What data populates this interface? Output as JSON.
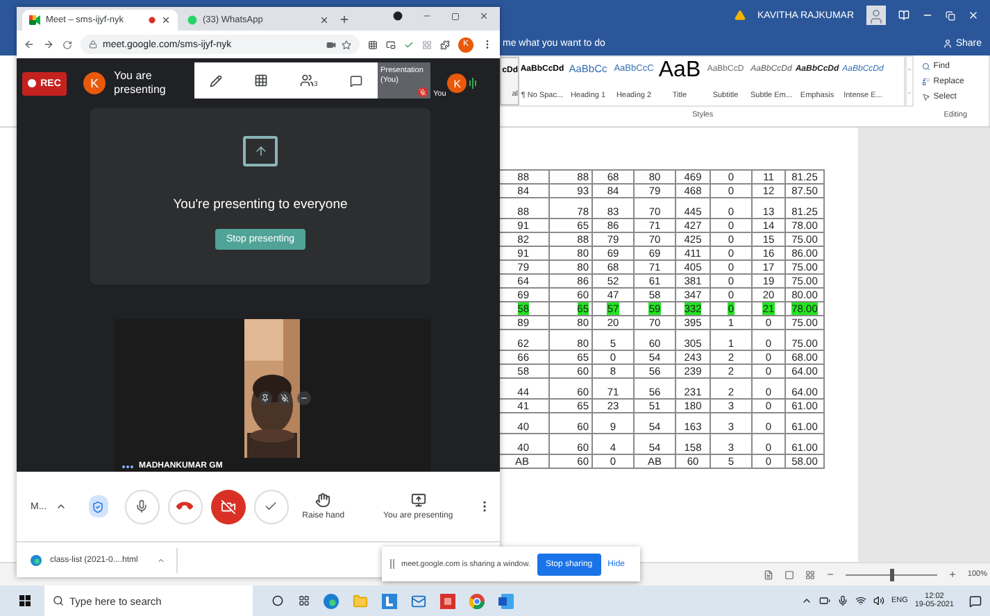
{
  "word": {
    "user": "KAVITHA RAJKUMAR",
    "tell_me": "me what you want to do",
    "share": "Share",
    "styles": [
      {
        "kind": "normal",
        "preview": "cDd",
        "label": "al",
        "selected": true
      },
      {
        "kind": "normal",
        "preview": "AaBbCcDd",
        "label": "¶ No Spac...",
        "selected": false
      },
      {
        "kind": "heading1",
        "preview": "AaBbCc",
        "label": "Heading 1",
        "selected": false
      },
      {
        "kind": "heading2",
        "preview": "AaBbCcC",
        "label": "Heading 2",
        "selected": false
      },
      {
        "kind": "title",
        "preview": "AaB",
        "label": "Title",
        "selected": false
      },
      {
        "kind": "subtitle",
        "preview": "AaBbCcD",
        "label": "Subtitle",
        "selected": false
      },
      {
        "kind": "subtle",
        "preview": "AaBbCcDd",
        "label": "Subtle Em...",
        "selected": false
      },
      {
        "kind": "emphasis",
        "preview": "AaBbCcDd",
        "label": "Emphasis",
        "selected": false
      },
      {
        "kind": "intense",
        "preview": "AaBbCcDd",
        "label": "Intense E...",
        "selected": false
      }
    ],
    "styles_group": "Styles",
    "editing": [
      {
        "kind": "find",
        "label": "Find"
      },
      {
        "kind": "replace",
        "label": "Replace"
      },
      {
        "kind": "select",
        "label": "Select"
      }
    ],
    "editing_group": "Editing",
    "table_rows": [
      {
        "cells": [
          "88",
          "88",
          "68",
          "80",
          "469",
          "0",
          "11",
          "81.25"
        ],
        "highlighted": false,
        "tall": false
      },
      {
        "cells": [
          "84",
          "93",
          "84",
          "79",
          "468",
          "0",
          "12",
          "87.50"
        ],
        "highlighted": false,
        "tall": false
      },
      {
        "cells": [
          "88",
          "78",
          "83",
          "70",
          "445",
          "0",
          "13",
          "81.25"
        ],
        "highlighted": false,
        "tall": true
      },
      {
        "cells": [
          "91",
          "65",
          "86",
          "71",
          "427",
          "0",
          "14",
          "78.00"
        ],
        "highlighted": false,
        "tall": false
      },
      {
        "cells": [
          "82",
          "88",
          "79",
          "70",
          "425",
          "0",
          "15",
          "75.00"
        ],
        "highlighted": false,
        "tall": false
      },
      {
        "cells": [
          "91",
          "80",
          "69",
          "69",
          "411",
          "0",
          "16",
          "86.00"
        ],
        "highlighted": false,
        "tall": false
      },
      {
        "cells": [
          "79",
          "80",
          "68",
          "71",
          "405",
          "0",
          "17",
          "75.00"
        ],
        "highlighted": false,
        "tall": false
      },
      {
        "cells": [
          "64",
          "86",
          "52",
          "61",
          "381",
          "0",
          "19",
          "75.00"
        ],
        "highlighted": false,
        "tall": false
      },
      {
        "cells": [
          "69",
          "60",
          "47",
          "58",
          "347",
          "0",
          "20",
          "80.00"
        ],
        "highlighted": false,
        "tall": false
      },
      {
        "cells": [
          "58",
          "65",
          "57",
          "59",
          "332",
          "0",
          "21",
          "78.00"
        ],
        "highlighted": true,
        "tall": false
      },
      {
        "cells": [
          "89",
          "80",
          "20",
          "70",
          "395",
          "1",
          "0",
          "75.00"
        ],
        "highlighted": false,
        "tall": false
      },
      {
        "cells": [
          "62",
          "80",
          "5",
          "60",
          "305",
          "1",
          "0",
          "75.00"
        ],
        "highlighted": false,
        "tall": true
      },
      {
        "cells": [
          "66",
          "65",
          "0",
          "54",
          "243",
          "2",
          "0",
          "68.00"
        ],
        "highlighted": false,
        "tall": false
      },
      {
        "cells": [
          "58",
          "60",
          "8",
          "56",
          "239",
          "2",
          "0",
          "64.00"
        ],
        "highlighted": false,
        "tall": false
      },
      {
        "cells": [
          "44",
          "60",
          "71",
          "56",
          "231",
          "2",
          "0",
          "64.00"
        ],
        "highlighted": false,
        "tall": true
      },
      {
        "cells": [
          "41",
          "65",
          "23",
          "51",
          "180",
          "3",
          "0",
          "61.00"
        ],
        "highlighted": false,
        "tall": false
      },
      {
        "cells": [
          "40",
          "60",
          "9",
          "54",
          "163",
          "3",
          "0",
          "61.00"
        ],
        "highlighted": false,
        "tall": true
      },
      {
        "cells": [
          "40",
          "60",
          "4",
          "54",
          "158",
          "3",
          "0",
          "61.00"
        ],
        "highlighted": false,
        "tall": true
      },
      {
        "cells": [
          "AB",
          "60",
          "0",
          "AB",
          "60",
          "5",
          "0",
          "58.00"
        ],
        "highlighted": false,
        "tall": false
      }
    ],
    "zoom": {
      "level": 0.5,
      "reading": "100%"
    }
  },
  "chrome": {
    "tabs": [
      {
        "title": "Meet – sms-ijyf-nyk",
        "selected": true
      },
      {
        "title": "(33) WhatsApp",
        "selected": false
      }
    ],
    "url": "meet.google.com/sms-ijyf-nyk",
    "avatar": "K"
  },
  "meet": {
    "rec": "REC",
    "avatar": "K",
    "status": "You are presenting",
    "people_count": "3",
    "self_tile": "Presentation (You)",
    "self_label": "You",
    "self_avatar": "K",
    "present_title": "You're presenting to everyone",
    "stop_presenting": "Stop presenting",
    "participant": "MADHANKUMAR GM",
    "meeting_code": "M...",
    "controls": [
      {
        "kind": "mic"
      },
      {
        "kind": "hangup"
      },
      {
        "kind": "camera_off"
      },
      {
        "kind": "check"
      },
      {
        "kind": "raise_hand",
        "label": "Raise hand"
      },
      {
        "kind": "present",
        "label": "You are presenting"
      }
    ]
  },
  "download": {
    "file": "class-list (2021-0....html"
  },
  "share_bar": {
    "message": "meet.google.com is sharing a window.",
    "stop": "Stop sharing",
    "hide": "Hide"
  },
  "taskbar": {
    "search_placeholder": "Type here to search",
    "language": "ENG",
    "time": "12:02",
    "date": "19-05-2021"
  }
}
